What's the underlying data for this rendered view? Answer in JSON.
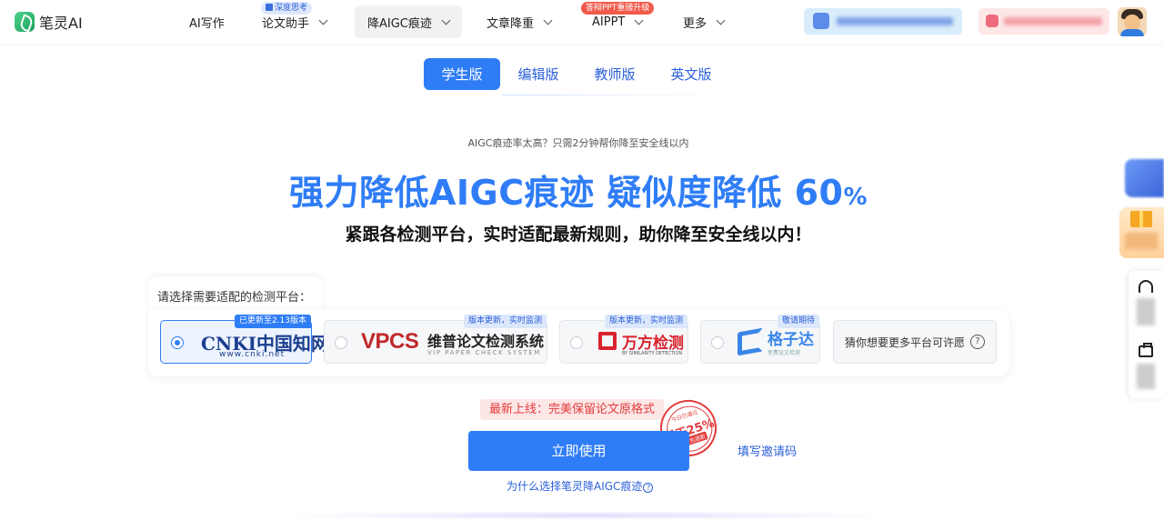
{
  "brand": {
    "name": "笔灵AI"
  },
  "nav": {
    "items": [
      {
        "label": "AI写作"
      },
      {
        "label": "论文助手",
        "badge": "深度思考"
      },
      {
        "label": "降AIGC痕迹"
      },
      {
        "label": "文章降重"
      },
      {
        "label": "AIPPT",
        "badge": "答辩PPT重磅升级"
      },
      {
        "label": "更多"
      }
    ]
  },
  "tabs": [
    {
      "label": "学生版",
      "active": true
    },
    {
      "label": "编辑版",
      "active": false
    },
    {
      "label": "教师版",
      "active": false
    },
    {
      "label": "英文版",
      "active": false
    }
  ],
  "hero": {
    "kicker": "AIGC痕迹率太高？只需2分钟帮你降至安全线以内",
    "headline": "强力降低AIGC痕迹 疑似度降低",
    "headline_number": "60",
    "headline_unit": "%",
    "subline": "紧跟各检测平台，实时适配最新规则，助你降至安全线以内！"
  },
  "platform": {
    "title": "请选择需要适配的检测平台：",
    "options": [
      {
        "name": "CNKI 中国知网",
        "logo_main": "CNKI中国知网",
        "logo_sub": "www.cnki.net",
        "badge": "已更新至2.13版本",
        "selected": true
      },
      {
        "name": "VPCS 维普论文检测系统",
        "logo_main": "VPCS",
        "logo_cn": "维普论文检测系统",
        "logo_en": "VIP PAPER CHECK SYSTEM",
        "badge": "版本更新，实时监测",
        "selected": false
      },
      {
        "name": "万方检测",
        "logo_main": "万方检测",
        "logo_en": "BY SIMILARITY DETECTION",
        "badge": "版本更新，实时监测",
        "selected": false
      },
      {
        "name": "格子达",
        "logo_main": "格子达",
        "logo_en": "免费论文检测",
        "badge": "敬请期待",
        "selected": false
      }
    ],
    "more_label": "猜你想要更多平台可许愿"
  },
  "promo": {
    "notice": "最新上线：完美保留论文原格式",
    "stamp_top": "今日已通过",
    "stamp_main": "低于25%",
    "stamp_bottom": "不过包退款"
  },
  "cta": {
    "label": "立即使用"
  },
  "invite": {
    "label": "填写邀请码"
  },
  "why": {
    "label": "为什么选择笔灵降AIGC痕迹"
  },
  "colors": {
    "primary": "#2f7df6",
    "danger": "#e23b3b"
  }
}
